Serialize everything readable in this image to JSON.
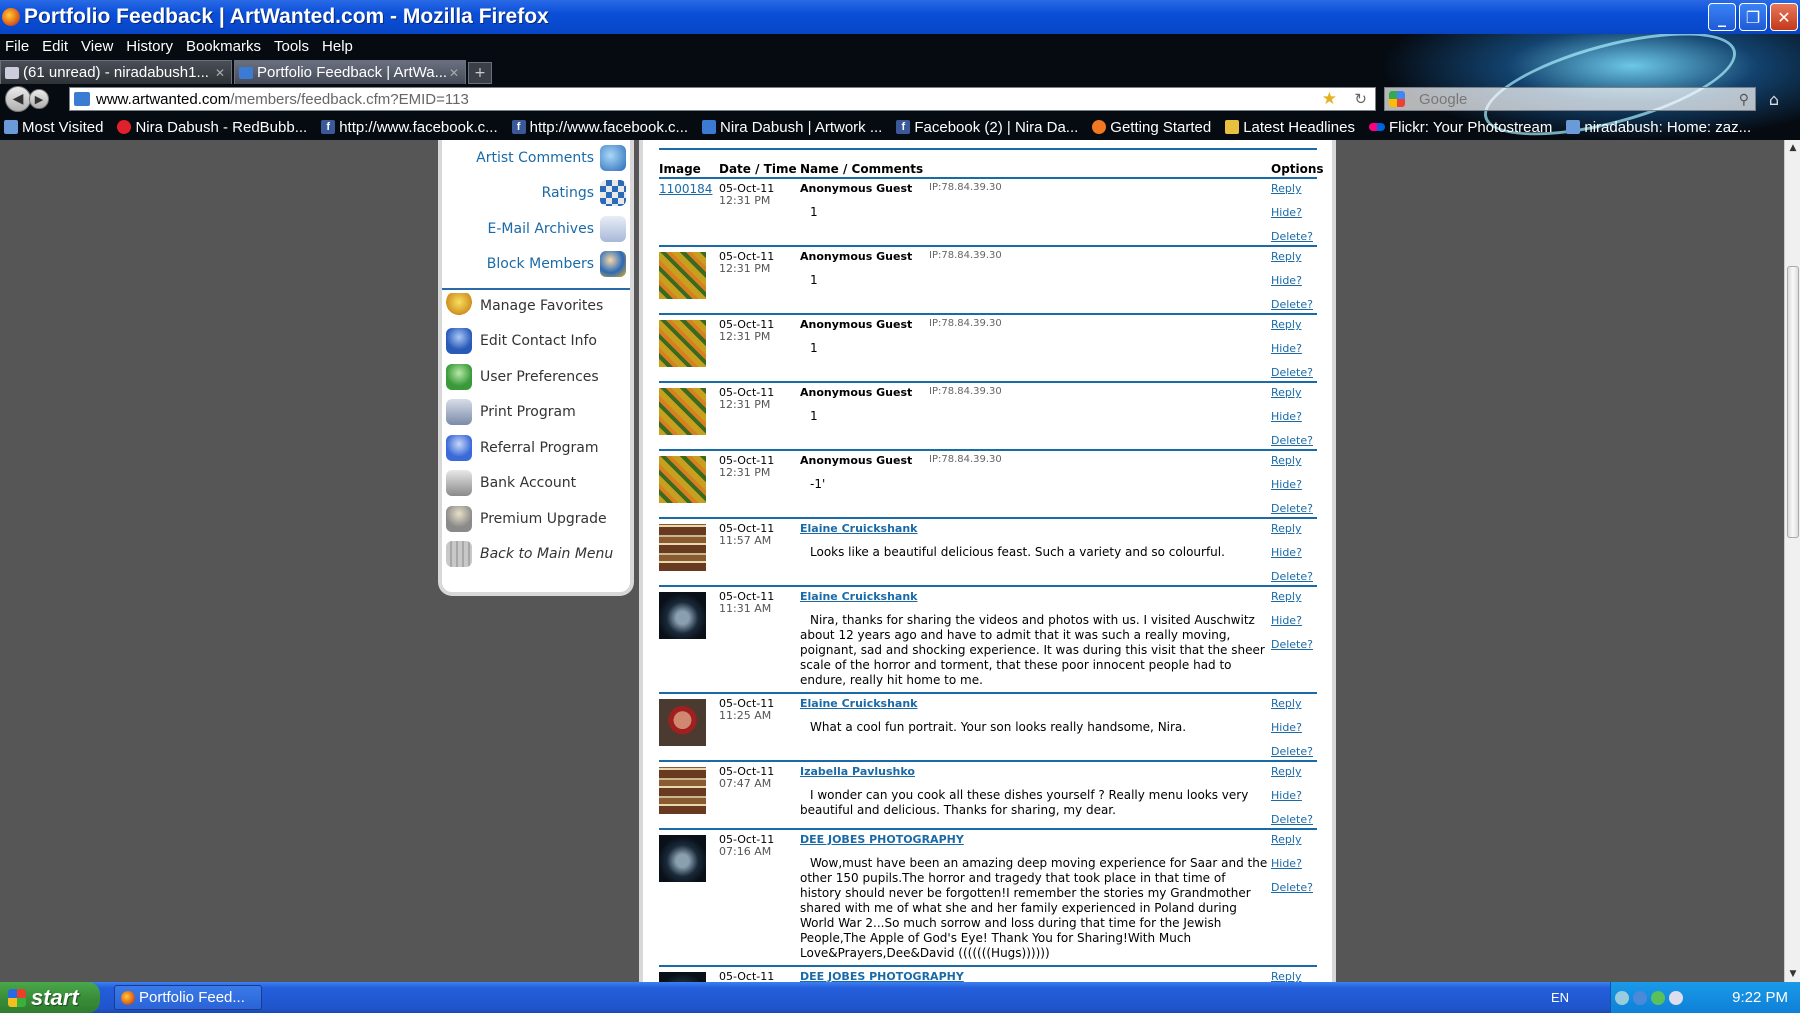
{
  "window": {
    "title": "Portfolio Feedback | ArtWanted.com - Mozilla Firefox",
    "min": "_",
    "max": "❐",
    "close": "✕"
  },
  "menu": [
    "File",
    "Edit",
    "View",
    "History",
    "Bookmarks",
    "Tools",
    "Help"
  ],
  "tabs": [
    {
      "label": "(61 unread) - niradabush1...",
      "active": false
    },
    {
      "label": "Portfolio Feedback | ArtWa...",
      "active": true
    }
  ],
  "new_tab": "+",
  "url": {
    "domain": "www.artwanted.com",
    "path": "/members/feedback.cfm?EMID=113"
  },
  "search": {
    "placeholder": "Google"
  },
  "bookmarks": [
    {
      "label": "Most Visited",
      "icon": "mv"
    },
    {
      "label": "Nira Dabush - RedBubb...",
      "icon": "red"
    },
    {
      "label": "http://www.facebook.c...",
      "icon": "fb"
    },
    {
      "label": "http://www.facebook.c...",
      "icon": "fb"
    },
    {
      "label": "Nira Dabush | Artwork ...",
      "icon": "aw"
    },
    {
      "label": "Facebook (2) | Nira Da...",
      "icon": "fb"
    },
    {
      "label": "Getting Started",
      "icon": "orange"
    },
    {
      "label": "Latest Headlines",
      "icon": "folder"
    },
    {
      "label": "Flickr: Your Photostream",
      "icon": "flickr"
    },
    {
      "label": "niradabush: Home: zaz...",
      "icon": "mv"
    }
  ],
  "sidebar": {
    "top_items": [
      "Artist Comments",
      "Ratings",
      "E-Mail Archives",
      "Block Members"
    ],
    "bottom_items": [
      "Manage Favorites",
      "Edit Contact Info",
      "User Preferences",
      "Print Program",
      "Referral Program",
      "Bank Account",
      "Premium Upgrade",
      "Back to Main Menu"
    ]
  },
  "feedback": {
    "headers": {
      "image": "Image",
      "datetime": "Date / Time",
      "name": "Name / Comments",
      "options": "Options"
    },
    "reply": "Reply",
    "hide": "Hide?",
    "delete": "Delete?",
    "rows": [
      {
        "image_link": "1100184",
        "date": "05-Oct-11",
        "time": "12:31 PM",
        "name": "Anonymous Guest",
        "ip": "IP:78.84.39.30",
        "comment": "1"
      },
      {
        "thumb": "sunflower",
        "date": "05-Oct-11",
        "time": "12:31 PM",
        "name": "Anonymous Guest",
        "ip": "IP:78.84.39.30",
        "comment": "1"
      },
      {
        "thumb": "sunflower",
        "date": "05-Oct-11",
        "time": "12:31 PM",
        "name": "Anonymous Guest",
        "ip": "IP:78.84.39.30",
        "comment": "1"
      },
      {
        "thumb": "sunflower",
        "date": "05-Oct-11",
        "time": "12:31 PM",
        "name": "Anonymous Guest",
        "ip": "IP:78.84.39.30",
        "comment": "1"
      },
      {
        "thumb": "sunflower",
        "date": "05-Oct-11",
        "time": "12:31 PM",
        "name": "Anonymous Guest",
        "ip": "IP:78.84.39.30",
        "comment": "-1'"
      },
      {
        "thumb": "feast",
        "date": "05-Oct-11",
        "time": "11:57 AM",
        "name": "Elaine Cruickshank",
        "comment": "Looks like a beautiful delicious feast. Such a variety and so colourful."
      },
      {
        "thumb": "dark",
        "date": "05-Oct-11",
        "time": "11:31 AM",
        "name": "Elaine Cruickshank",
        "comment": "Nira, thanks for sharing the videos and photos with us. I visited Auschwitz about 12 years ago and have to admit that it was such a really moving, poignant, sad and shocking experience. It was during this visit that the sheer scale of the horror and torment, that these poor innocent people had to endure, really hit home to me."
      },
      {
        "thumb": "portrait",
        "date": "05-Oct-11",
        "time": "11:25 AM",
        "name": "Elaine Cruickshank",
        "comment": "What a cool fun portrait. Your son looks really handsome, Nira."
      },
      {
        "thumb": "feast",
        "date": "05-Oct-11",
        "time": "07:47 AM",
        "name": "Izabella Pavlushko",
        "comment": "I wonder can you cook all these dishes yourself ? Really menu looks very beautiful and delicious. Thanks for sharing, my dear."
      },
      {
        "thumb": "dark",
        "date": "05-Oct-11",
        "time": "07:16 AM",
        "name": "DEE JOBES PHOTOGRAPHY",
        "comment": "Wow,must have been an amazing deep moving experience for Saar and the other 150 pupils.The horror and tragedy that took place in that time of history should never be forgotten!I remember the stories my Grandmother shared with me of what she and her family experienced in Poland during World War 2...So much sorrow and loss during that time for the Jewish People,The Apple of God's Eye! Thank You for Sharing!With Much Love&Prayers,Dee&David (((((((Hugs))))))"
      },
      {
        "thumb": "dark",
        "date": "05-Oct-11",
        "time": "",
        "name": "DEE JOBES PHOTOGRAPHY",
        "comment": ""
      }
    ]
  },
  "taskbar": {
    "start": "start",
    "task": "Portfolio Feed...",
    "lang": "EN",
    "clock": "9:22 PM"
  }
}
